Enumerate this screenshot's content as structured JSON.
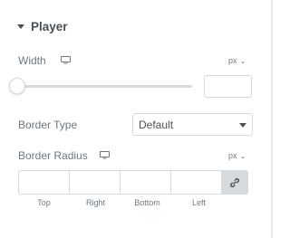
{
  "section": {
    "title": "Player"
  },
  "width_control": {
    "label": "Width",
    "unit": "px",
    "value": "",
    "device_icon": "desktop-icon"
  },
  "border_type": {
    "label": "Border Type",
    "selected": "Default"
  },
  "border_radius": {
    "label": "Border Radius",
    "unit": "px",
    "device_icon": "desktop-icon",
    "fields": [
      {
        "label": "Top",
        "value": ""
      },
      {
        "label": "Right",
        "value": ""
      },
      {
        "label": "Bottom",
        "value": ""
      },
      {
        "label": "Left",
        "value": ""
      }
    ],
    "link_icon": "link-icon"
  },
  "slider": {
    "level": 0
  }
}
